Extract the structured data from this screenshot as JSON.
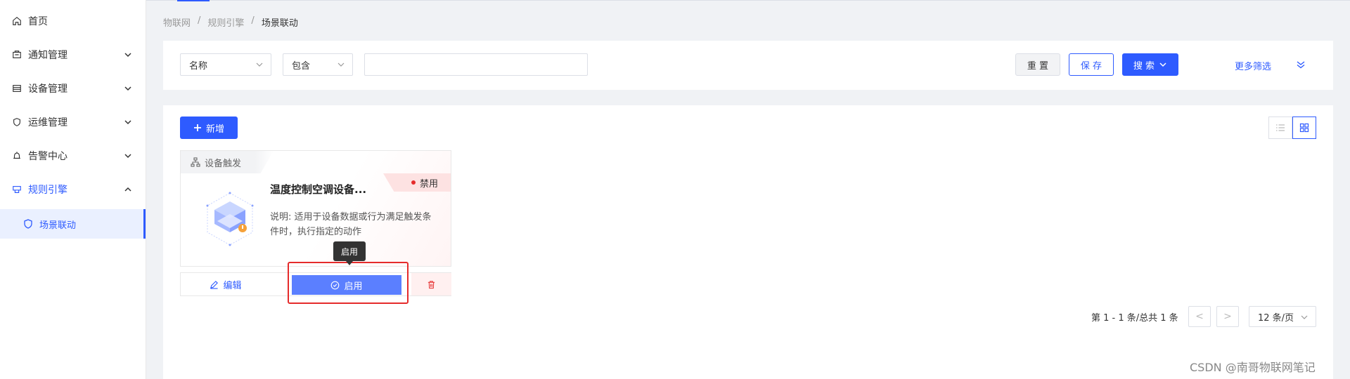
{
  "sidebar": {
    "items": [
      {
        "label": "首页",
        "icon": "home-icon"
      },
      {
        "label": "通知管理",
        "icon": "notification-icon"
      },
      {
        "label": "设备管理",
        "icon": "device-icon"
      },
      {
        "label": "运维管理",
        "icon": "ops-icon"
      },
      {
        "label": "告警中心",
        "icon": "alarm-icon"
      },
      {
        "label": "规则引擎",
        "icon": "rule-icon"
      }
    ],
    "sub_item": {
      "label": "场景联动",
      "icon": "scene-icon"
    }
  },
  "breadcrumb": [
    "物联网",
    "规则引擎",
    "场景联动"
  ],
  "breadcrumb_sep": "/",
  "filter": {
    "field_select": "名称",
    "op_select": "包含",
    "value": "",
    "reset_label": "重 置",
    "save_label": "保 存",
    "search_label": "搜 索",
    "more_label": "更多筛选"
  },
  "content": {
    "add_label": "新增",
    "card": {
      "tag": "设备触发",
      "status": "禁用",
      "title": "温度控制空调设备...",
      "desc": "说明: 适用于设备数据或行为满足触发条件时，执行指定的动作",
      "edit_label": "编辑",
      "enable_label": "启用",
      "tooltip": "启用"
    },
    "pager": {
      "summary": "第 1 - 1 条/总共 1 条",
      "prev": "<",
      "next": ">",
      "page_size": "12 条/页"
    }
  },
  "watermark": "CSDN @南哥物联网笔记",
  "colors": {
    "primary": "#2e5bff",
    "danger": "#e52b2b",
    "bg": "#f0f2f5"
  }
}
